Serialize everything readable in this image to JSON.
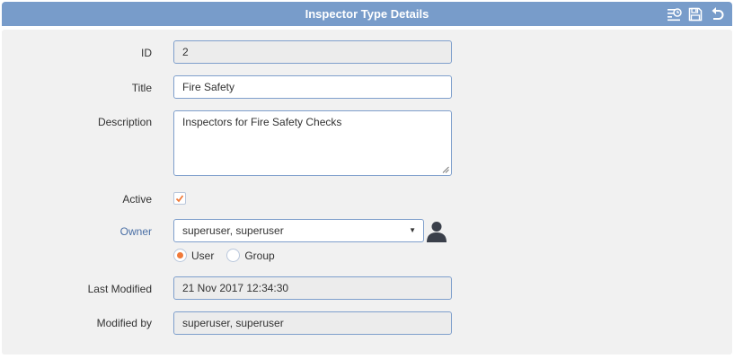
{
  "window": {
    "title": "Inspector Type Details",
    "icons": [
      "history-icon",
      "save-icon",
      "undo-icon"
    ]
  },
  "form": {
    "id": {
      "label": "ID",
      "value": "2"
    },
    "title": {
      "label": "Title",
      "value": "Fire Safety"
    },
    "description": {
      "label": "Description",
      "value": "Inspectors for Fire Safety Checks"
    },
    "active": {
      "label": "Active",
      "checked": true
    },
    "owner": {
      "label": "Owner",
      "selected": "superuser, superuser",
      "options": [
        {
          "label": "User",
          "selected": true
        },
        {
          "label": "Group",
          "selected": false
        }
      ]
    },
    "last_modified": {
      "label": "Last Modified",
      "value": "21 Nov 2017 12:34:30"
    },
    "modified_by": {
      "label": "Modified by",
      "value": "superuser, superuser"
    }
  },
  "colors": {
    "titlebar": "#789cca",
    "field_border": "#7f9fcc",
    "accent_check": "#f07a3a",
    "link": "#4a6fa5"
  }
}
